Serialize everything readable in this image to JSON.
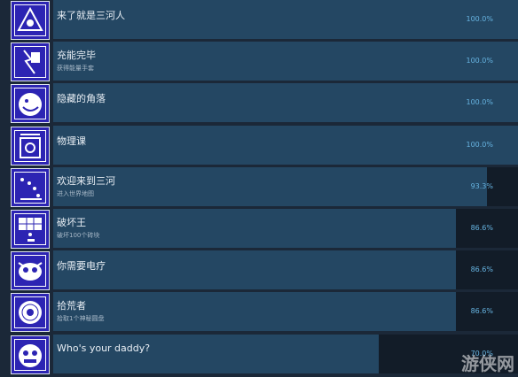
{
  "achievements": [
    {
      "title": "来了就是三河人",
      "desc": "",
      "percent": "100.0%",
      "fill": 1.0,
      "icon": "triangle-warning-icon"
    },
    {
      "title": "充能完毕",
      "desc": "获得能量手套",
      "percent": "100.0%",
      "fill": 1.0,
      "icon": "lightning-glove-icon"
    },
    {
      "title": "隐藏的角落",
      "desc": "",
      "percent": "100.0%",
      "fill": 1.0,
      "icon": "grinning-face-icon"
    },
    {
      "title": "物理课",
      "desc": "",
      "percent": "100.0%",
      "fill": 1.0,
      "icon": "physics-device-icon"
    },
    {
      "title": "欢迎来到三河",
      "desc": "进入世界地图",
      "percent": "93.3%",
      "fill": 0.933,
      "icon": "world-map-icon"
    },
    {
      "title": "破坏王",
      "desc": "破坏100个砖块",
      "percent": "86.6%",
      "fill": 0.866,
      "icon": "brick-wall-icon"
    },
    {
      "title": "你需要电疗",
      "desc": "",
      "percent": "86.6%",
      "fill": 0.866,
      "icon": "bug-face-icon"
    },
    {
      "title": "拾荒者",
      "desc": "拾取1个神秘圆盘",
      "percent": "86.6%",
      "fill": 0.866,
      "icon": "disc-icon"
    },
    {
      "title": "Who's your daddy?",
      "desc": "",
      "percent": "70.0%",
      "fill": 0.7,
      "icon": "monster-face-icon"
    }
  ],
  "watermark": "游侠网",
  "colors": {
    "background": "#1b2838",
    "fill": "#244763",
    "track": "#121c28",
    "percent": "#66b3e0",
    "icon_bg": "#2c24b3"
  }
}
